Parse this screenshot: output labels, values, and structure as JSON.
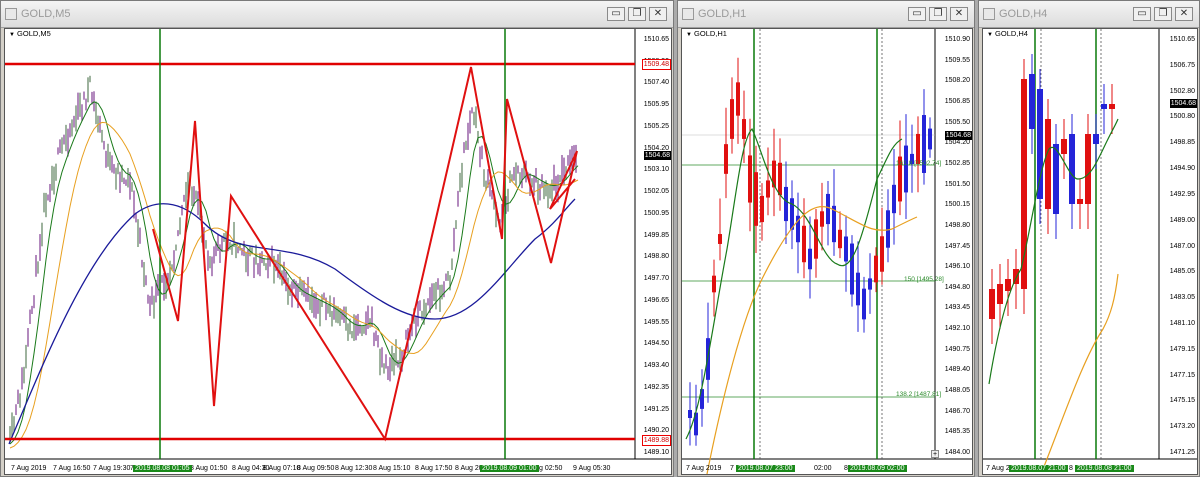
{
  "windows": [
    {
      "title": "GOLD,M5",
      "chart_label": "GOLD,M5",
      "y_labels": [
        "1510.65",
        "1508.90",
        "1507.40",
        "1505.95",
        "1505.25",
        "1504.20",
        "1503.10",
        "1502.05",
        "1500.95",
        "1499.85",
        "1498.80",
        "1497.70",
        "1496.65",
        "1495.55",
        "1494.50",
        "1493.40",
        "1492.35",
        "1491.25",
        "1490.20",
        "1489.10"
      ],
      "price_boxes": {
        "top_red": "1509.48",
        "current": "1504.68",
        "bottom_red": "1489.88"
      },
      "x_labels": [
        "7 Aug 2019",
        "7 Aug 16:50",
        "7 Aug 19:30",
        "7",
        "8 Aug 01:50",
        "8 Aug 04:30",
        "8 Aug 07:10",
        "8 Aug 09:50",
        "8 Aug 12:30",
        "8 Aug 15:10",
        "8 Aug 17:50",
        "8 Aug 20:3",
        "8 Aug 02:50",
        "9 Aug 05:30"
      ],
      "x_highlight": [
        "2019.08.08 01:05",
        "2019.08.09 01:00"
      ]
    },
    {
      "title": "GOLD,H1",
      "chart_label": "GOLD,H1",
      "y_labels": [
        "1510.90",
        "1509.55",
        "1508.20",
        "1506.85",
        "1505.50",
        "1504.20",
        "1502.85",
        "1501.50",
        "1500.15",
        "1498.80",
        "1497.45",
        "1496.10",
        "1494.80",
        "1493.45",
        "1492.10",
        "1490.75",
        "1489.40",
        "1488.05",
        "1486.70",
        "1485.35",
        "1484.00"
      ],
      "price_boxes": {
        "current": "1504.68"
      },
      "fib_labels": [
        "161.8 [1502.74]",
        "150 [1495.28]",
        "138.2 [1487.81]"
      ],
      "x_labels": [
        "7 Aug 2019",
        "7",
        "02:00",
        "8 Aug 10:00",
        "8 A"
      ],
      "x_highlight": [
        "2019.08.07 23:00",
        "2019.08.09 02:00"
      ]
    },
    {
      "title": "GOLD,H4",
      "chart_label": "GOLD,H4",
      "y_labels": [
        "1510.65",
        "1506.75",
        "1502.80",
        "1500.80",
        "1498.85",
        "1494.90",
        "1492.95",
        "1489.00",
        "1487.00",
        "1485.05",
        "1483.05",
        "1481.10",
        "1479.15",
        "1477.15",
        "1475.15",
        "1473.20",
        "1471.25"
      ],
      "price_boxes": {
        "current": "1504.68"
      },
      "x_labels": [
        "7 Aug 20",
        "8",
        "01:00"
      ],
      "x_highlight": [
        "2019.08.07 21:00",
        "2019.08.08 21:00"
      ]
    }
  ],
  "window_buttons": {
    "minimize": "▭",
    "restore": "❐",
    "close": "✕"
  },
  "colors": {
    "bull": "#2424d8",
    "bear": "#e01010",
    "ma_fast": "#1a7a1a",
    "ma_slow": "#e8a020",
    "ma_long": "#1a1a9a",
    "zigzag": "#e01010",
    "vline": "#0a7a0a",
    "level": "#e00000",
    "fib": "#2b8b2b"
  }
}
